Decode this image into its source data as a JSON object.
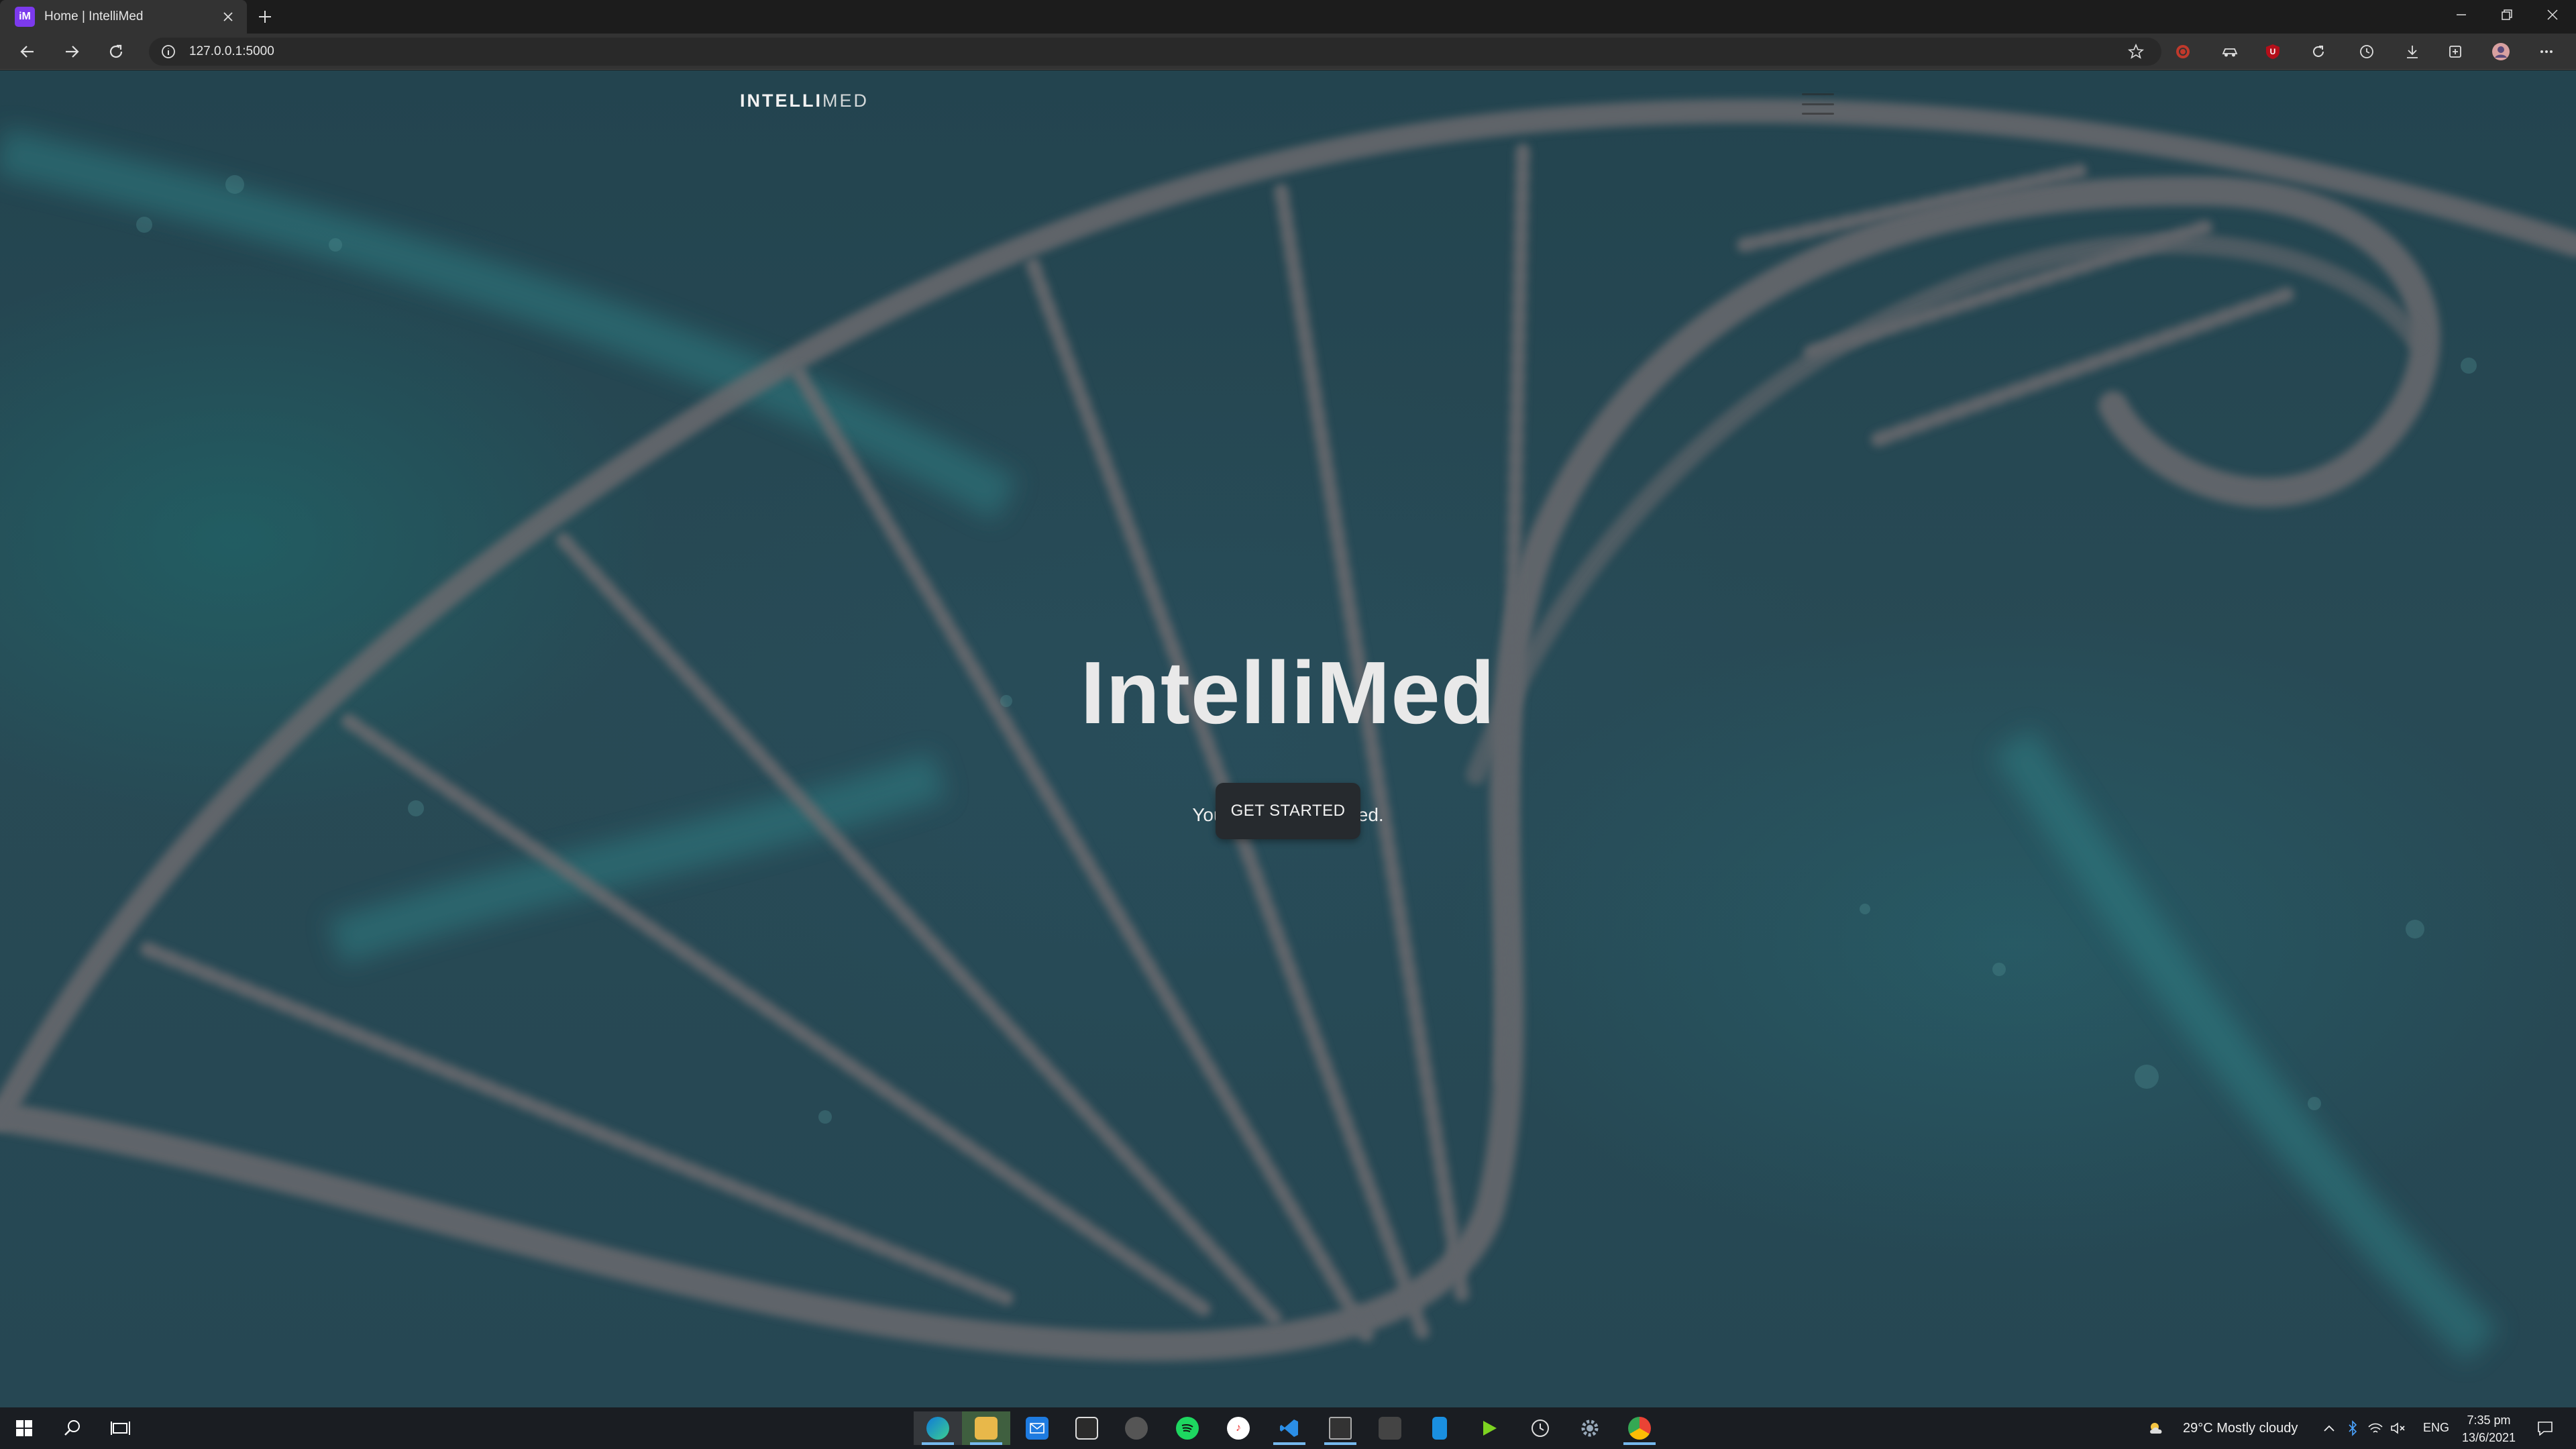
{
  "browser": {
    "tab_title": "Home | IntelliMed",
    "favicon_text": "iM",
    "url": "127.0.0.1:5000",
    "accent": "#7c3aed"
  },
  "site": {
    "brand_bold": "INTELLI",
    "brand_light": "MED",
    "hero_title": "IntelliMed",
    "hero_subtitle": "Your health. Simplified.",
    "cta_label": "GET STARTED"
  },
  "taskbar": {
    "weather": "29°C  Mostly cloudy",
    "language": "ENG",
    "time": "7:35 pm",
    "date": "13/6/2021"
  }
}
